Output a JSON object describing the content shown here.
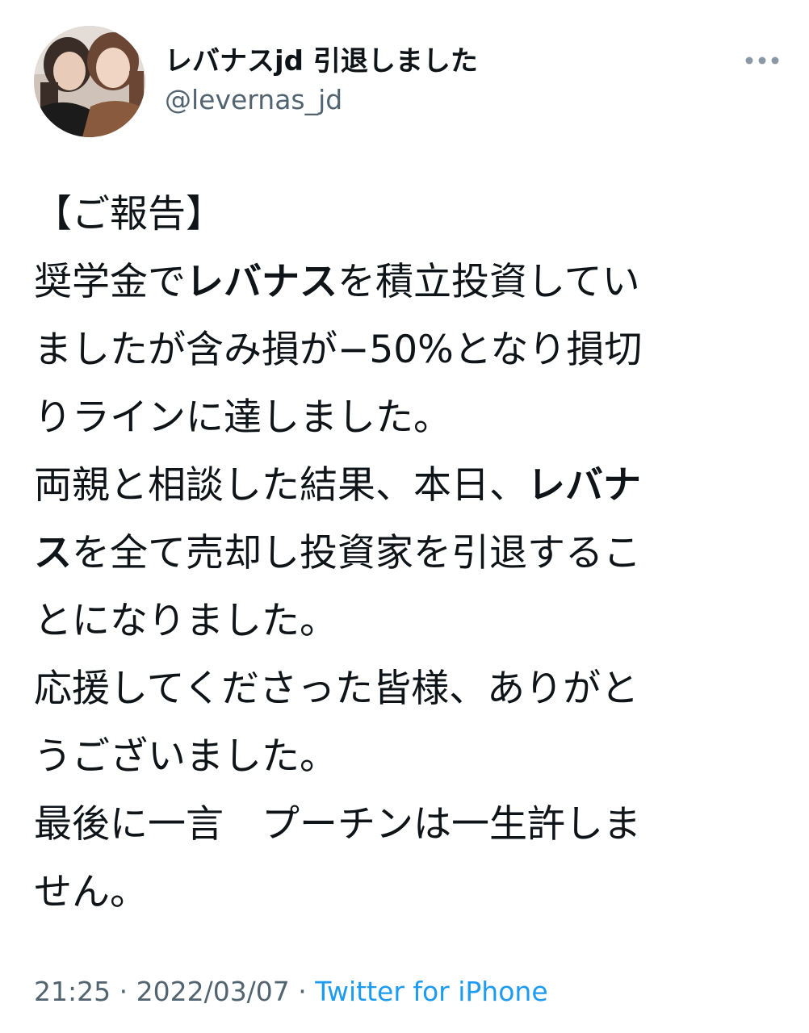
{
  "user": {
    "display_name": "レバナスjd 引退しました",
    "handle": "@levernas_jd"
  },
  "icons": {
    "avatar": "profile-photo",
    "more": "more-dots-icon"
  },
  "tweet": {
    "lines": [
      [
        {
          "t": "【ご報告】",
          "b": false
        }
      ],
      [
        {
          "t": "奨学金で",
          "b": false
        },
        {
          "t": "レバナス",
          "b": true
        },
        {
          "t": "を積立投資してい",
          "b": false
        }
      ],
      [
        {
          "t": "ましたが含み損が−50%となり損切",
          "b": false
        }
      ],
      [
        {
          "t": "りラインに達しました。",
          "b": false
        }
      ],
      [
        {
          "t": "両親と相談した結果、本日、",
          "b": false
        },
        {
          "t": "レバナ",
          "b": true
        }
      ],
      [
        {
          "t": "ス",
          "b": true
        },
        {
          "t": "を全て売却し投資家を引退するこ",
          "b": false
        }
      ],
      [
        {
          "t": "とになりました。",
          "b": false
        }
      ],
      [
        {
          "t": "応援してくださった皆様、ありがと",
          "b": false
        }
      ],
      [
        {
          "t": "うございました。",
          "b": false
        }
      ],
      [
        {
          "t": "最後に一言　プーチンは一生許しま",
          "b": false
        }
      ],
      [
        {
          "t": "せん。",
          "b": false
        }
      ]
    ]
  },
  "meta": {
    "time": "21:25",
    "separator": "·",
    "date": "2022/03/07",
    "source": "Twitter for iPhone"
  },
  "colors": {
    "text": "#0f1419",
    "secondary": "#536471",
    "link": "#1d9bf0"
  }
}
